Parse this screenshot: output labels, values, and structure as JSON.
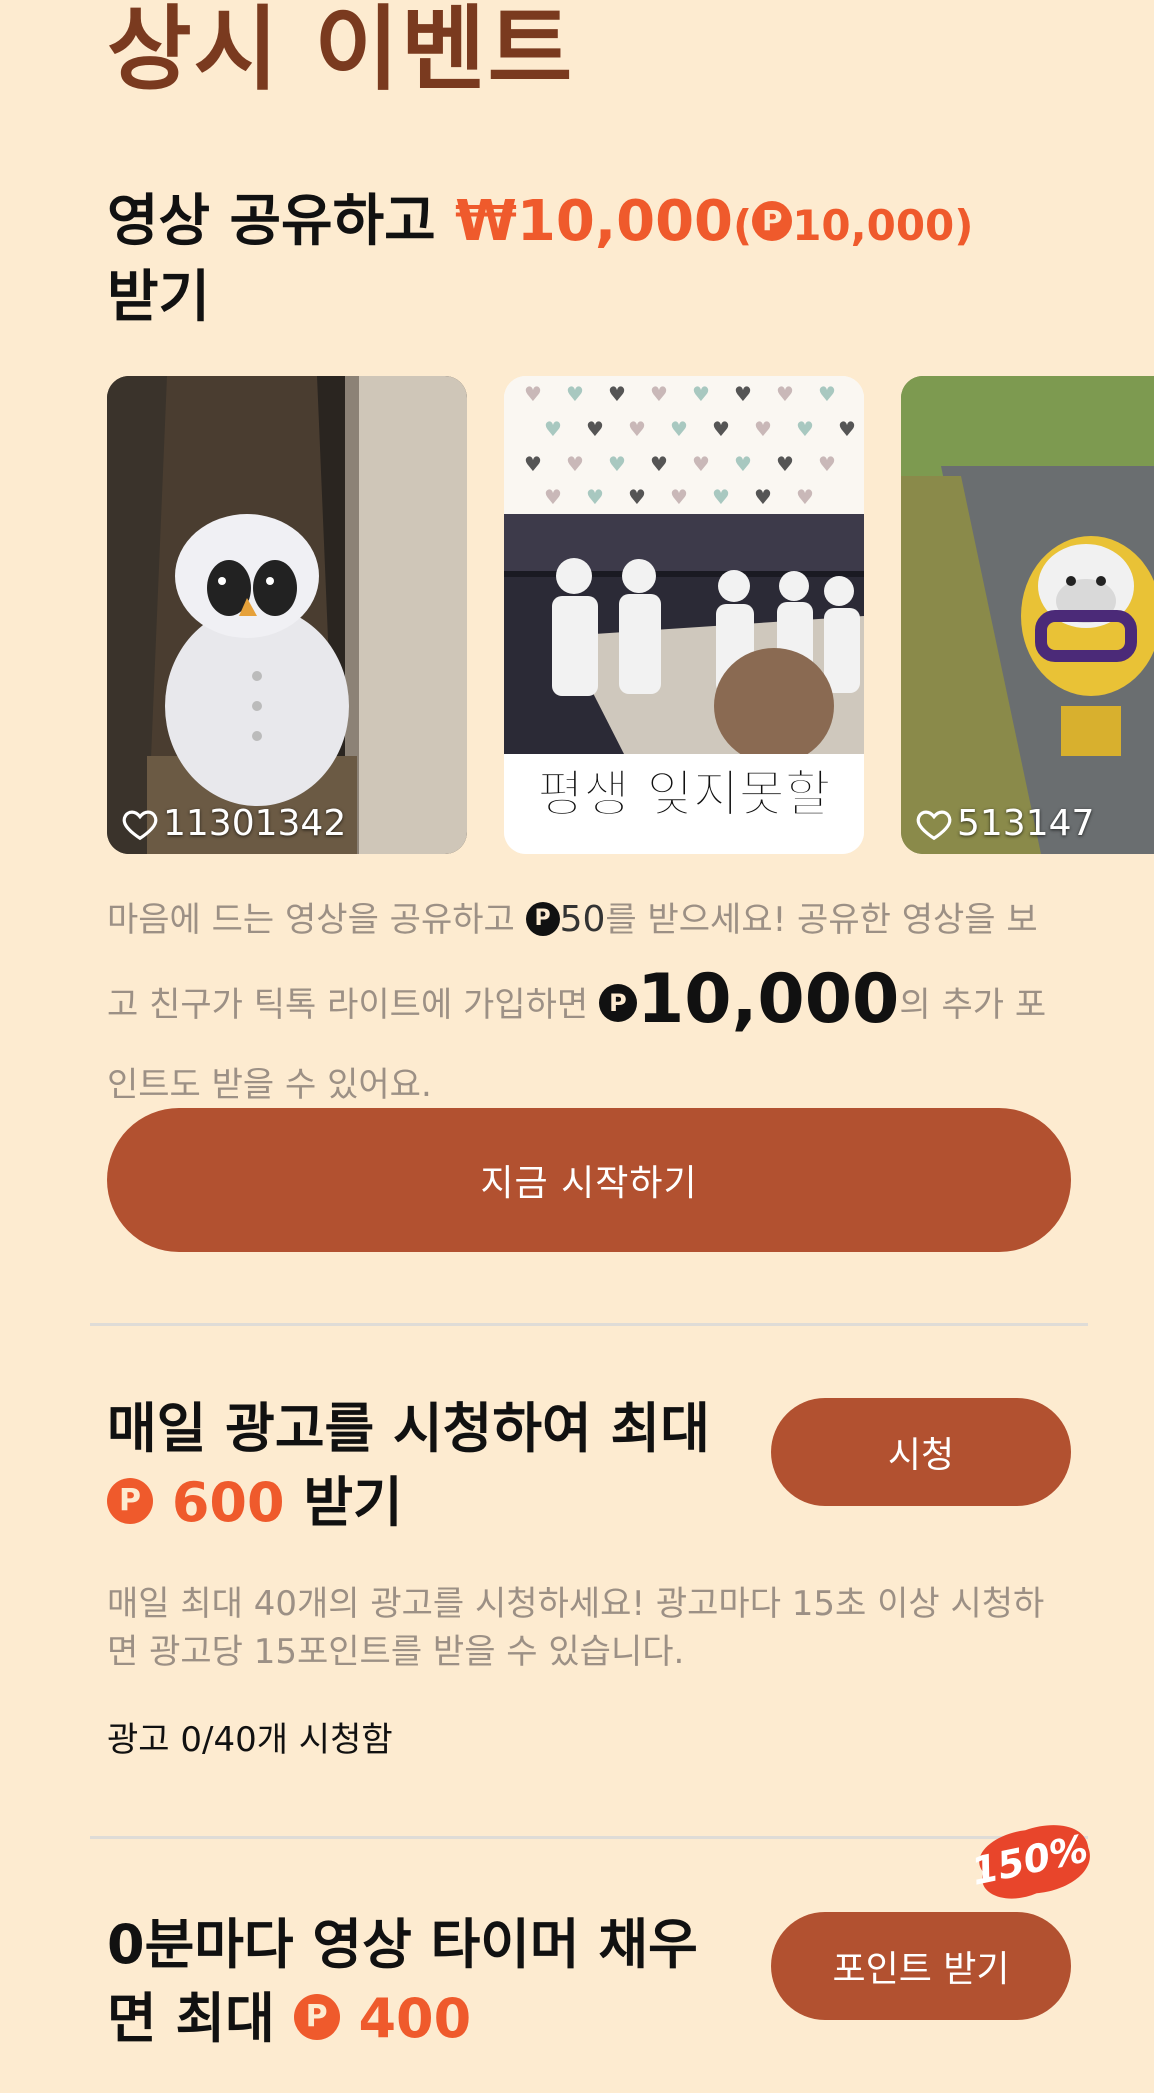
{
  "section": {
    "title": "상시 이벤트"
  },
  "share": {
    "title_prefix": "영상 공유하고 ",
    "reward_won": "₩10,000",
    "reward_paren_open": "(",
    "reward_coin": "P",
    "reward_points": "10,000",
    "reward_paren_close": ")",
    "title_suffix": " 받기",
    "videos": [
      {
        "likes": "11301342"
      },
      {
        "caption": "평생 잊지못할"
      },
      {
        "likes": "513147"
      }
    ],
    "desc_1": "마음에 드는 영상을 공유하고 ",
    "desc_coin": "P",
    "desc_points": "50",
    "desc_2": "를 받으세요! 공유한 영상을 보고 친구가 틱톡 라이트에 가입하면 ",
    "desc_coin2": "P",
    "desc_big": "10,000",
    "desc_3": "의 추가 포인트도 받을 수 있어요.",
    "start_button": "지금 시작하기"
  },
  "ads": {
    "title_1": "매일 광고를 시청하여 최대",
    "coin": "P",
    "amount": "600",
    "title_2": " 받기",
    "button": "시청",
    "description": "매일 최대 40개의 광고를 시청하세요! 광고마다 15초 이상 시청하면 광고당 15포인트를 받을 수 있습니다.",
    "count": "광고 0/40개 시청함"
  },
  "timer": {
    "title_1": "0분마다 영상 타이머 채우면 최대 ",
    "coin": "P",
    "amount": "400",
    "button": "포인트 받기",
    "badge": "150%"
  },
  "colors": {
    "background": "#fdebd0",
    "accent_brown": "#b25130",
    "reward_orange": "#ef5a2c",
    "title_brown": "#7a3a1f"
  },
  "icons": {
    "heart": "heart-outline-icon",
    "point": "point-coin-icon"
  }
}
